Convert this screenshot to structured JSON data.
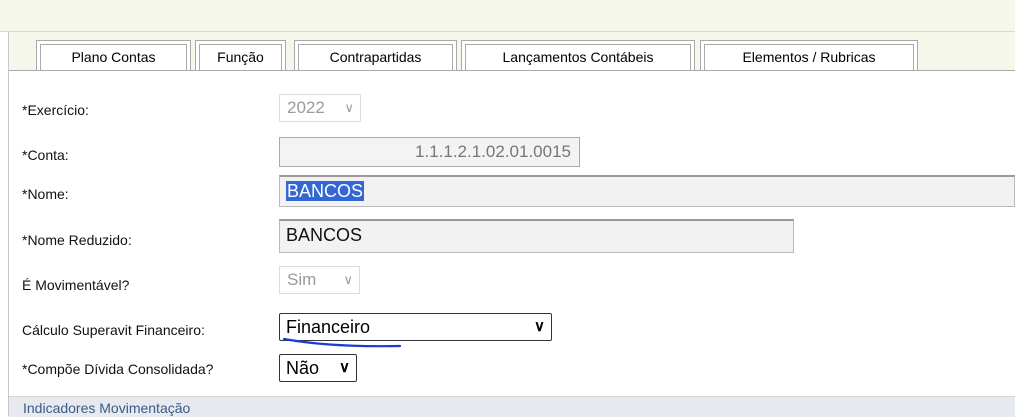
{
  "tabs": [
    {
      "label": "Plano Contas",
      "active": true
    },
    {
      "label": "Função",
      "active": false
    },
    {
      "label": "Contrapartidas",
      "active": false
    },
    {
      "label": "Lançamentos Contábeis",
      "active": false
    },
    {
      "label": "Elementos / Rubricas",
      "active": false
    }
  ],
  "form": {
    "exercicio": {
      "label": "*Exercício:",
      "value": "2022"
    },
    "conta": {
      "label": "*Conta:",
      "value": "1.1.1.2.1.02.01.0015"
    },
    "nome": {
      "label": "*Nome:",
      "value": "BANCOS"
    },
    "nome_reduzido": {
      "label": "*Nome Reduzido:",
      "value": "BANCOS"
    },
    "movimentavel": {
      "label": "É Movimentável?",
      "value": "Sim"
    },
    "calculo_superavit": {
      "label": "Cálculo Superavit Financeiro:",
      "value": "Financeiro"
    },
    "divida_consolidada": {
      "label": "*Compõe Dívida Consolidada?",
      "value": "Não"
    }
  },
  "section": {
    "title": "Indicadores Movimentação"
  },
  "colors": {
    "selection": "#3367d6",
    "annotation_ink": "#1a3bd6",
    "top_band": "#f4f7ea"
  }
}
